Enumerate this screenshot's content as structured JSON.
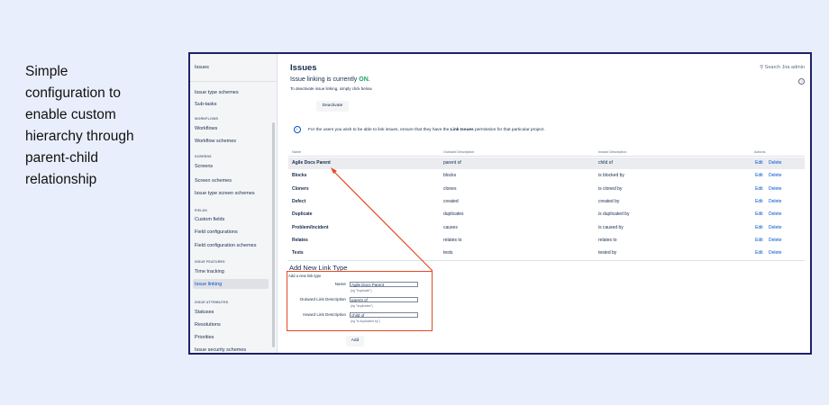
{
  "caption": [
    "Simple",
    "configuration to",
    "enable custom",
    "hierarchy through",
    "parent-child",
    "relationship"
  ],
  "sidebar": {
    "header": "Issues",
    "entries": [
      {
        "kind": "item",
        "label": "Issue type schemes"
      },
      {
        "kind": "item",
        "label": "Sub-tasks"
      },
      {
        "kind": "section",
        "label": "WORKFLOWS"
      },
      {
        "kind": "item",
        "label": "Workflows"
      },
      {
        "kind": "item",
        "label": "Workflow schemes"
      },
      {
        "kind": "section",
        "label": "SCREENS"
      },
      {
        "kind": "item",
        "label": "Screens"
      },
      {
        "kind": "item",
        "label": "Screen schemes"
      },
      {
        "kind": "item",
        "label": "Issue type screen schemes"
      },
      {
        "kind": "section",
        "label": "FIELDS"
      },
      {
        "kind": "item",
        "label": "Custom fields"
      },
      {
        "kind": "item",
        "label": "Field configurations"
      },
      {
        "kind": "item",
        "label": "Field configuration schemes"
      },
      {
        "kind": "section",
        "label": "ISSUE FEATURES"
      },
      {
        "kind": "item",
        "label": "Time tracking"
      },
      {
        "kind": "item",
        "label": "Issue linking",
        "active": true
      },
      {
        "kind": "section",
        "label": "ISSUE ATTRIBUTES"
      },
      {
        "kind": "item",
        "label": "Statuses"
      },
      {
        "kind": "item",
        "label": "Resolutions"
      },
      {
        "kind": "item",
        "label": "Priorities"
      },
      {
        "kind": "item",
        "label": "Issue security schemes"
      }
    ]
  },
  "header": {
    "title": "Issues",
    "search": "Search Jira admin",
    "help_glyph": "?"
  },
  "status": {
    "prefix": "Issue linking is currently ",
    "state": "ON",
    "suffix": ".",
    "instruction": "To deactivate issue linking, simply click below.",
    "deactivate_label": "Deactivate"
  },
  "info": {
    "text_before": "For the users you wish to be able to link issues, ensure that they have the ",
    "text_bold": "Link Issues",
    "text_after": " permission for that particular project."
  },
  "table": {
    "headers": [
      "Name",
      "Outward Description",
      "Inward Description",
      "Actions"
    ],
    "edit_label": "Edit",
    "delete_label": "Delete",
    "rows": [
      {
        "name": "Agile Docs Parent",
        "outward": "parent of",
        "inward": "child of",
        "highlight": true
      },
      {
        "name": "Blocks",
        "outward": "blocks",
        "inward": "is blocked by"
      },
      {
        "name": "Cloners",
        "outward": "clones",
        "inward": "is cloned by"
      },
      {
        "name": "Defect",
        "outward": "created",
        "inward": "created by"
      },
      {
        "name": "Duplicate",
        "outward": "duplicates",
        "inward": "is duplicated by"
      },
      {
        "name": "Problem/Incident",
        "outward": "causes",
        "inward": "is caused by"
      },
      {
        "name": "Relates",
        "outward": "relates to",
        "inward": "relates to"
      },
      {
        "name": "Tests",
        "outward": "tests",
        "inward": "tested by"
      }
    ]
  },
  "add_form": {
    "title": "Add New Link Type",
    "subtitle": "Add a new link type",
    "name_label": "Name",
    "name_value": "Agile Docs Parent",
    "name_hint": "(eg \"Duplicate\")",
    "outward_label": "Outward Link Description",
    "outward_value": "parent of",
    "outward_hint": "(eg \"duplicates\")",
    "inward_label": "Inward Link Description",
    "inward_value": "child of",
    "inward_hint": "(eg \"is duplicated by\")",
    "add_label": "Add"
  },
  "colors": {
    "frame": "#1d2266",
    "annotation": "#e34a24",
    "link": "#0052cc",
    "on": "#22a06b"
  }
}
